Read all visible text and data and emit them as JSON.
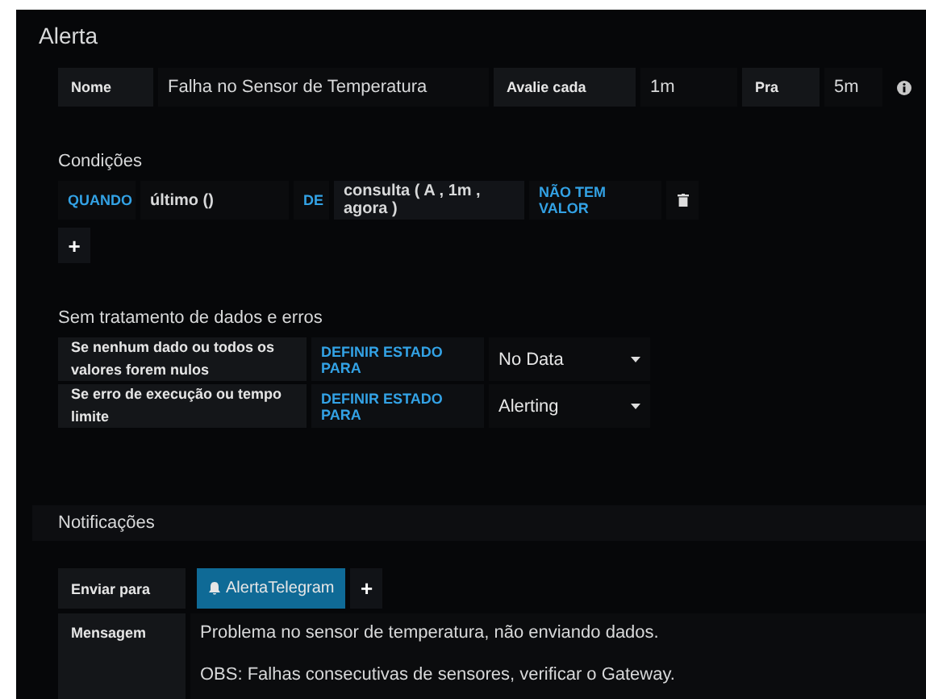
{
  "title": "Alerta",
  "rule": {
    "name_label": "Nome",
    "name": "Falha no Sensor de Temperatura",
    "eval_label": "Avalie cada",
    "eval": "1m",
    "for_label": "Pra",
    "for": "5m"
  },
  "conditions": {
    "title": "Condições",
    "when": "QUANDO",
    "reducer": "último ()",
    "of": "DE",
    "query": "consulta ( A , 1m , agora )",
    "evaluator": "NÃO TEM VALOR",
    "add": "+"
  },
  "handling": {
    "title": "Sem tratamento de dados e erros",
    "rows": [
      {
        "label": "Se nenhum dado ou todos os valores forem nulos",
        "action": "DEFINIR ESTADO PARA",
        "value": "No Data"
      },
      {
        "label": "Se erro de execução ou tempo limite",
        "action": "DEFINIR ESTADO PARA",
        "value": "Alerting"
      }
    ]
  },
  "notifications": {
    "title": "Notificações",
    "send_label": "Enviar para",
    "channels": [
      "AlertaTelegram"
    ],
    "add": "+",
    "message_label": "Mensagem",
    "message": [
      "Problema no sensor de temperatura, não enviando dados.",
      "OBS: Falhas consecutivas de sensores, verificar o Gateway."
    ]
  }
}
